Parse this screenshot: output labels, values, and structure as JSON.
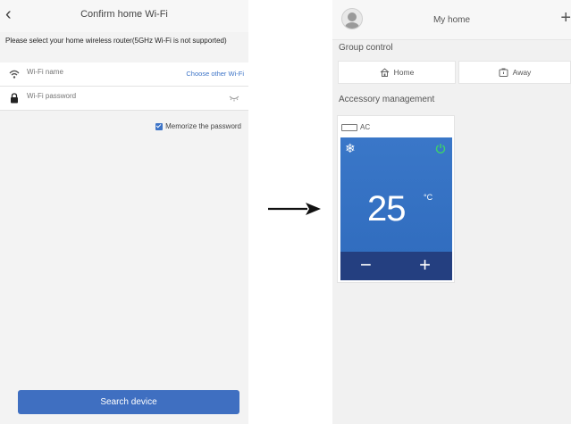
{
  "left_screen": {
    "title": "Confirm home Wi-Fi",
    "back_glyph": "‹",
    "note": "Please select your home wireless router(5GHz Wi-Fi is not supported)",
    "wifi_name": {
      "placeholder": "Wi-Fi name",
      "icon": "wifi-icon"
    },
    "choose_other": "Choose other Wi-Fi",
    "wifi_password": {
      "placeholder": "Wi-Fi password",
      "icon": "lock-icon"
    },
    "memorize": {
      "label": "Memorize the password",
      "checked": true
    },
    "search_button": "Search device",
    "accent_color": "#3f6fc1"
  },
  "right_screen": {
    "title": "My home",
    "plus_glyph": "+",
    "group_label": "Group control",
    "group_buttons": [
      {
        "label": "Home",
        "icon": "home-icon"
      },
      {
        "label": "Away",
        "icon": "away-icon"
      }
    ],
    "accessory_label": "Accessory management",
    "ac_card": {
      "name": "AC",
      "mode_glyph": "❄",
      "temperature": "25",
      "temperature_unit": "°C",
      "minus_glyph": "−",
      "plus_glyph": "+",
      "power_on": true,
      "power_color": "#3dd16a",
      "panel_color": "#3a77c8"
    }
  }
}
